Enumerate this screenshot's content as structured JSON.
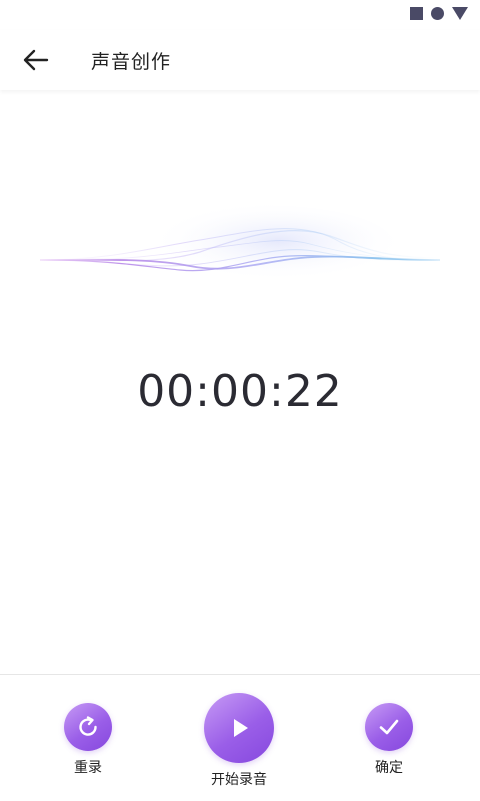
{
  "status_bar": {
    "icons": [
      "square-icon",
      "circle-icon",
      "triangle-icon"
    ]
  },
  "header": {
    "back_icon": "arrow-left-icon",
    "title": "声音创作"
  },
  "recorder": {
    "timer": "00:00:22"
  },
  "controls": {
    "redo_label": "重录",
    "record_label": "开始录音",
    "confirm_label": "确定"
  },
  "colors": {
    "accent": "#9a5ee8",
    "accent_light": "#c79bf5",
    "wave_purple": "#b98ae8",
    "wave_blue": "#8ec5ee"
  }
}
